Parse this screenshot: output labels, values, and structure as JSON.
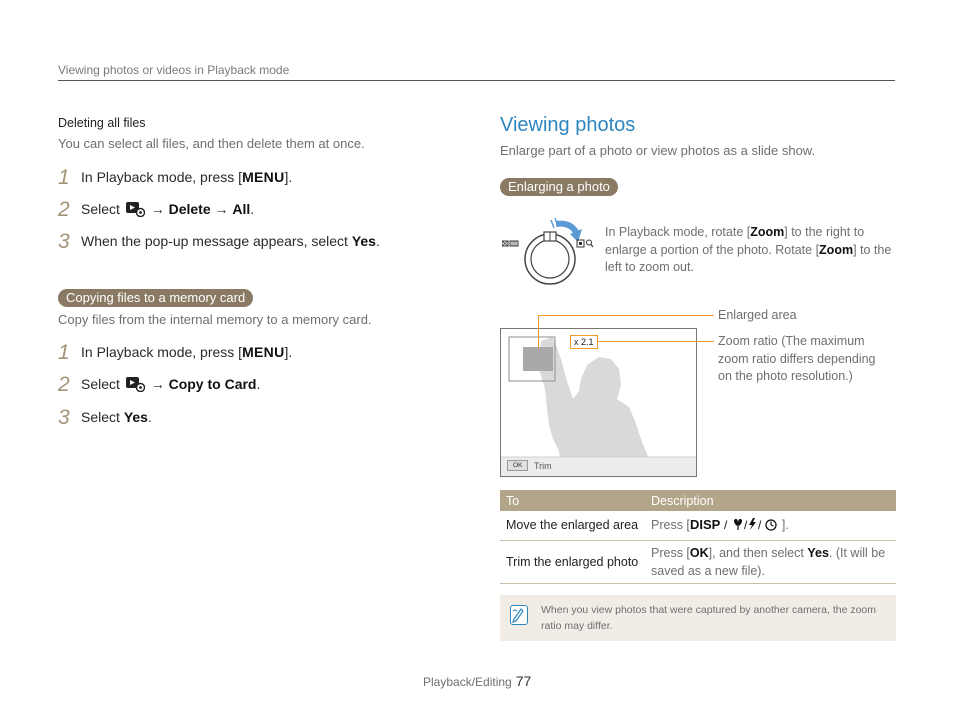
{
  "header": "Viewing photos or videos in Playback mode",
  "left": {
    "delete_all": {
      "heading": "Deleting all files",
      "desc": "You can select all files, and then delete them at once.",
      "steps": [
        {
          "num": "1",
          "pre": "In Playback mode, press [",
          "key": "MENU",
          "post": "]."
        },
        {
          "num": "2",
          "pre": "Select",
          "icon": "playback-settings-icon",
          "arrow1": "→",
          "opt1": "Delete",
          "arrow2": "→",
          "opt2": "All",
          "post": "."
        },
        {
          "num": "3",
          "pre": "When the pop-up message appears, select ",
          "opt": "Yes",
          "post": "."
        }
      ]
    },
    "copy": {
      "pill": "Copying files to a memory card",
      "desc": "Copy files from the internal memory to a memory card.",
      "steps": [
        {
          "num": "1",
          "pre": "In Playback mode, press [",
          "key": "MENU",
          "post": "]."
        },
        {
          "num": "2",
          "pre": "Select",
          "icon": "playback-settings-icon",
          "arrow1": "→",
          "opt1": "Copy to Card",
          "post": "."
        },
        {
          "num": "3",
          "pre": "Select ",
          "opt": "Yes",
          "post": "."
        }
      ]
    }
  },
  "right": {
    "title": "Viewing photos",
    "desc": "Enlarge part of a photo or view photos as a slide show.",
    "pill": "Enlarging a photo",
    "zoom_text": {
      "t1": "In Playback mode, rotate [",
      "k1": "Zoom",
      "t2": "] to the right to enlarge a portion of the photo. Rotate [",
      "k2": "Zoom",
      "t3": "] to the left to zoom out."
    },
    "photo": {
      "zoom_label": "x 2.1",
      "ok_key": "OK",
      "trim_label": "Trim"
    },
    "callouts": {
      "enlarged": "Enlarged area",
      "ratio": "Zoom ratio (The maximum zoom ratio differs depending on the photo resolution.)"
    },
    "table": {
      "headers": [
        "To",
        "Description"
      ],
      "rows": [
        {
          "to": "Move the enlarged area",
          "d_pre": "Press [",
          "d_keys": "DISP/macro/flash/timer",
          "d_post": "]."
        },
        {
          "to": "Trim the enlarged photo",
          "d_pre": "Press [",
          "d_key": "OK",
          "d_mid": "], and then select ",
          "d_opt": "Yes",
          "d_post": ". (It will be saved as a new file)."
        }
      ]
    },
    "note": "When you view photos that were captured by another camera, the zoom ratio may differ."
  },
  "footer": {
    "section": "Playback/Editing",
    "page": "77"
  },
  "colors": {
    "accent_blue": "#2e86c1",
    "pill_brown": "#8a7a63",
    "table_header": "#b3a58a",
    "step_number": "#a39276",
    "callout_orange": "#f39a2a"
  }
}
